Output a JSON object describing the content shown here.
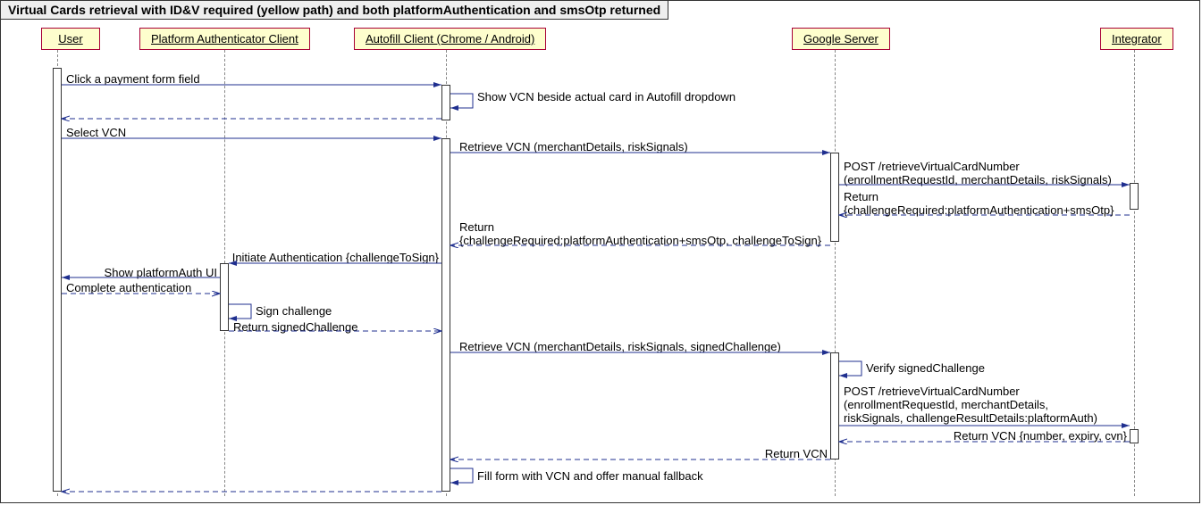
{
  "title": "Virtual Cards retrieval with ID&V required (yellow path) and both platformAuthentication and smsOtp returned",
  "actors": {
    "user": "User",
    "pac": "Platform Authenticator Client",
    "autofill": "Autofill Client (Chrome / Android)",
    "google": "Google Server",
    "integrator": "Integrator"
  },
  "messages": {
    "m1": "Click a payment form field",
    "m2": "Show VCN beside actual card in Autofill dropdown",
    "m3": "Select VCN",
    "m4": "Retrieve VCN (merchantDetails, riskSignals)",
    "m5a": "POST /retrieveVirtualCardNumber",
    "m5b": "(enrollmentRequestId, merchantDetails, riskSignals)",
    "m6a": "Return",
    "m6b": "{challengeRequired:platformAuthentication+smsOtp}",
    "m7a": "Return",
    "m7b": "{challengeRequired:platformAuthentication+smsOtp, challengeToSign}",
    "m8": "Initiate Authentication {challengeToSign}",
    "m9": "Show platformAuth UI",
    "m10": "Complete authentication",
    "m11": "Sign challenge",
    "m12": "Return signedChallenge",
    "m13": "Retrieve VCN (merchantDetails, riskSignals, signedChallenge)",
    "m14": "Verify signedChallenge",
    "m15a": "POST /retrieveVirtualCardNumber",
    "m15b": "(enrollmentRequestId, merchantDetails,",
    "m15c": "riskSignals, challengeResultDetails:plaftormAuth)",
    "m16": "Return VCN {number, expiry, cvn}",
    "m17": "Return VCN",
    "m18": "Fill form with VCN and offer manual fallback"
  }
}
